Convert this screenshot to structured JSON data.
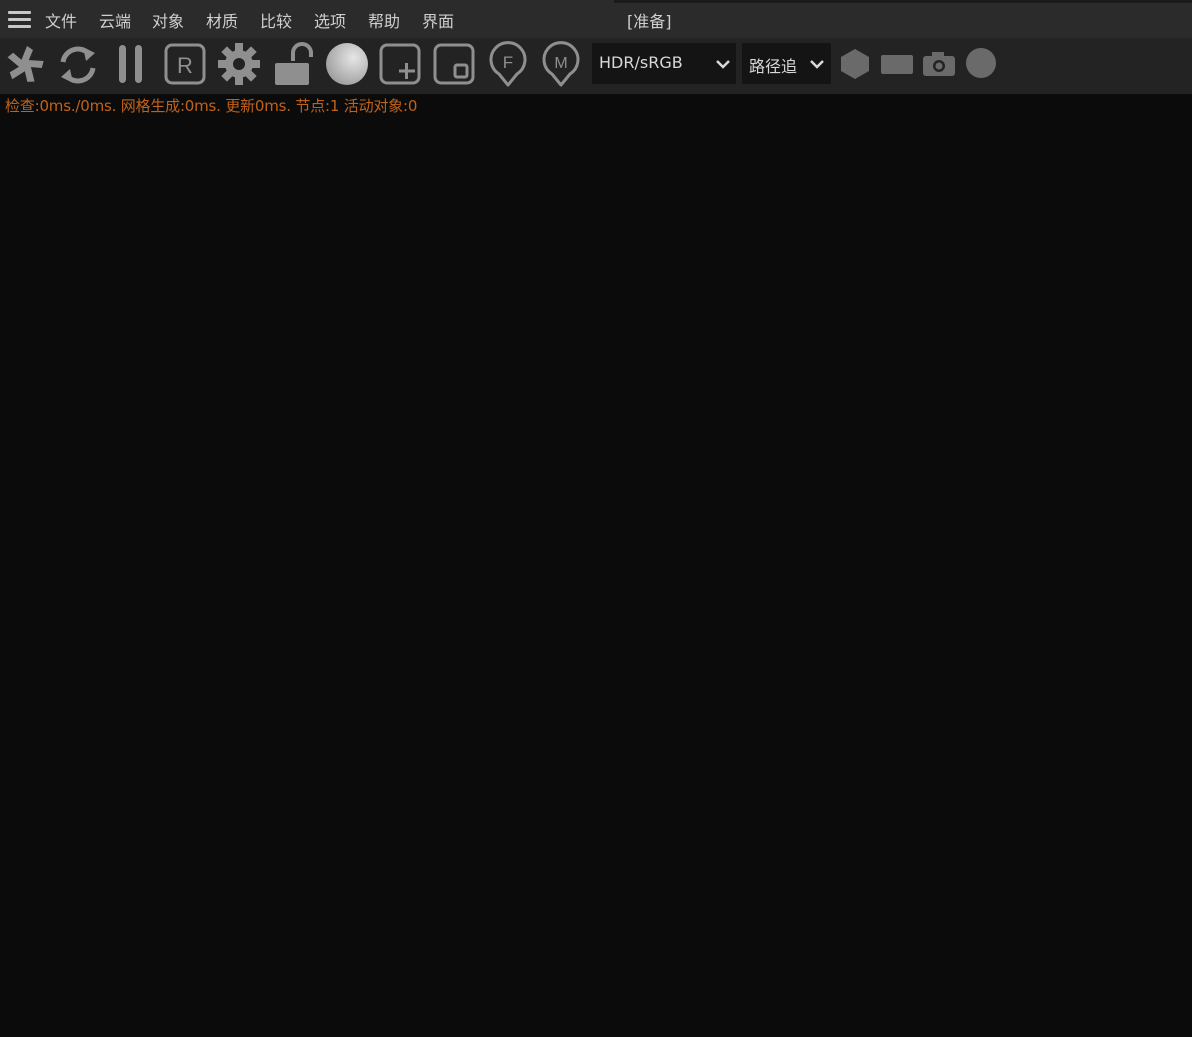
{
  "menubar": {
    "items": [
      "文件",
      "云端",
      "对象",
      "材质",
      "比较",
      "选项",
      "帮助",
      "界面"
    ],
    "status": "[准备]"
  },
  "toolbar": {
    "icons": [
      "octane-logo-icon",
      "refresh-icon",
      "pause-icon",
      "r-box-icon",
      "settings-gear-icon",
      "unlock-icon",
      "sphere-icon",
      "add-region-icon",
      "focus-region-icon",
      "f-pin-icon",
      "m-pin-icon"
    ],
    "colorspace_select": {
      "value": "HDR/sRGB"
    },
    "kernel_select": {
      "value": "路径追"
    },
    "right_icons": [
      "hexagon-icon",
      "rectangle-icon",
      "camera-icon",
      "circle-icon"
    ]
  },
  "stats_text": "检查:0ms./0ms. 网格生成:0ms. 更新0ms. 节点:1 活动对象:0",
  "colors": {
    "menubar_bg": "#2b2b2b",
    "toolbar_bg": "#232323",
    "viewport_bg": "#0b0b0b",
    "icon": "#8f8f8f",
    "stats_text": "#c0621b"
  }
}
